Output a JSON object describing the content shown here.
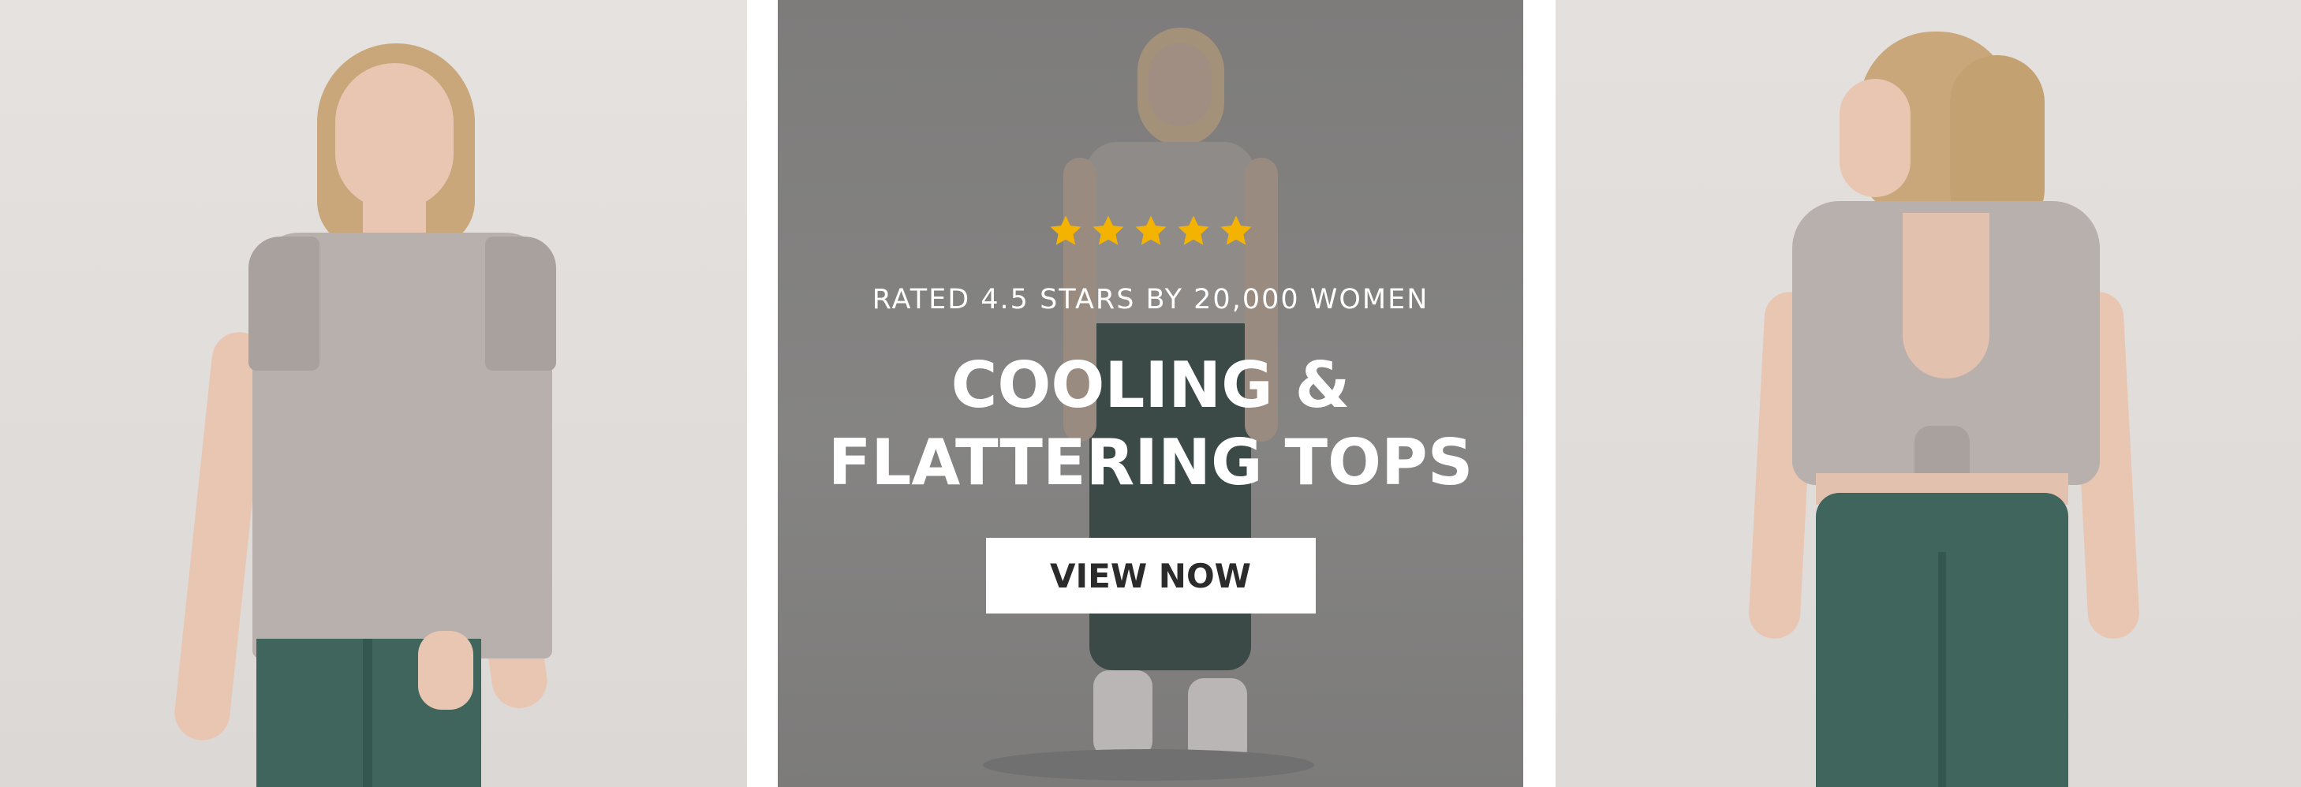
{
  "promo": {
    "rating": 5,
    "rating_max": 5,
    "rating_text": "RATED 4.5 STARS BY 20,000 WOMEN",
    "headline_line1": "COOLING &",
    "headline_line2": "FLATTERING TOPS",
    "cta_label": "VIEW NOW"
  },
  "colors": {
    "star": "#f5b301",
    "overlay": "#7f7e7d",
    "cta_bg": "#ffffff",
    "cta_text": "#2b2b2b",
    "leggings": "#3f655d",
    "tee": "#b7b0ad"
  },
  "images": {
    "left": "model-front-view-image",
    "middle": "model-full-body-image",
    "right": "model-back-view-image"
  }
}
